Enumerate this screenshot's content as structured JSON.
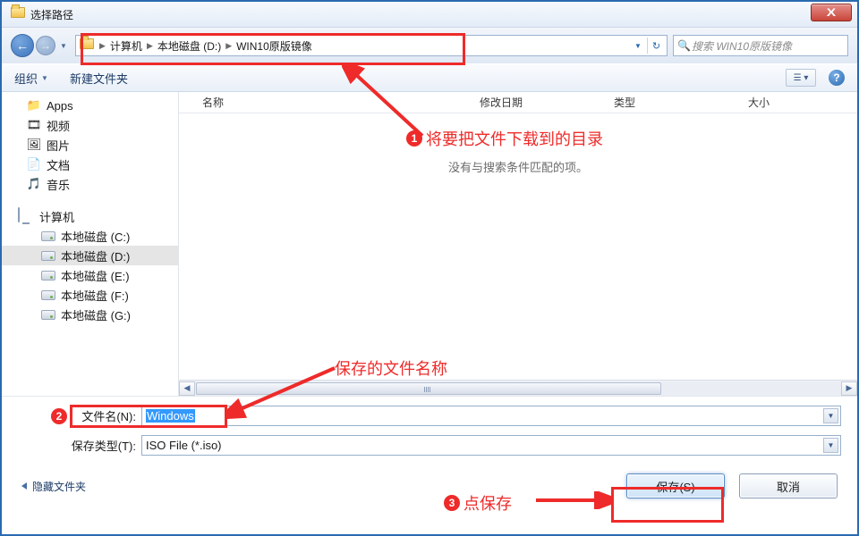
{
  "window": {
    "title": "选择路径"
  },
  "breadcrumb": {
    "root_arrow": "▶",
    "items": [
      "计算机",
      "本地磁盘 (D:)",
      "WIN10原版镜像"
    ]
  },
  "search": {
    "placeholder": "搜索 WIN10原版镜像"
  },
  "toolbar": {
    "organize": "组织",
    "new_folder": "新建文件夹"
  },
  "columns": {
    "name": "名称",
    "modified": "修改日期",
    "type": "类型",
    "size": "大小"
  },
  "empty_msg": "没有与搜索条件匹配的项。",
  "sidebar": {
    "favorites": [
      {
        "label": "Apps",
        "icon": "📁"
      },
      {
        "label": "视频",
        "icon": "🎞"
      },
      {
        "label": "图片",
        "icon": "🖼"
      },
      {
        "label": "文档",
        "icon": "📄"
      },
      {
        "label": "音乐",
        "icon": "🎵"
      }
    ],
    "computer_label": "计算机",
    "drives": [
      {
        "label": "本地磁盘 (C:)"
      },
      {
        "label": "本地磁盘 (D:)",
        "selected": true
      },
      {
        "label": "本地磁盘 (E:)"
      },
      {
        "label": "本地磁盘 (F:)"
      },
      {
        "label": "本地磁盘 (G:)"
      }
    ]
  },
  "form": {
    "filename_label": "文件名(N):",
    "filename_value": "Windows",
    "filetype_label": "保存类型(T):",
    "filetype_value": "ISO File (*.iso)"
  },
  "footer": {
    "hide_folders": "隐藏文件夹",
    "save": "保存(S)",
    "cancel": "取消"
  },
  "annotations": {
    "a1": "将要把文件下载到的目录",
    "a2": "保存的文件名称",
    "a3": "点保存"
  }
}
